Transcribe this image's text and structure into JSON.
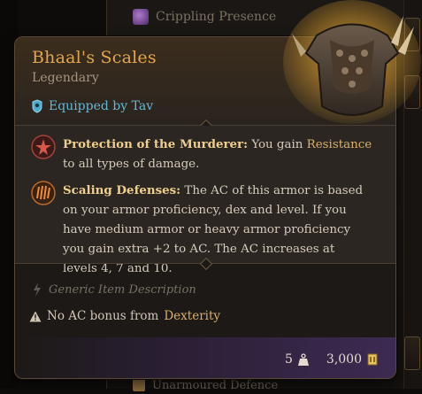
{
  "background": {
    "top_item": "Crippling Presence",
    "bottom_item": "Unarmoured Defence"
  },
  "tooltip": {
    "name": "Bhaal's Scales",
    "rarity": "Legendary",
    "equipped": "Equipped by Tav",
    "passives": [
      {
        "title": "Protection of the Murderer:",
        "parts": [
          "You gain",
          "Resistance",
          "to all types of damage."
        ],
        "icon": "skull-shield-icon"
      },
      {
        "title": "Scaling Defenses:",
        "text": "The AC of this armor is based on your armor proficiency, dex and level. If you have medium armor or heavy armor proficiency you gain extra +2 to AC. The AC increases at levels 4, 7 and 10.",
        "icon": "claw-defense-icon"
      }
    ],
    "description_label": "Generic Item Description",
    "warning": {
      "prefix": "No AC bonus from",
      "highlight": "Dexterity"
    },
    "weight": "5",
    "value": "3,000"
  },
  "colors": {
    "name": "#e3a64c",
    "equipped": "#63b7d6",
    "highlight": "#d9b06a"
  }
}
